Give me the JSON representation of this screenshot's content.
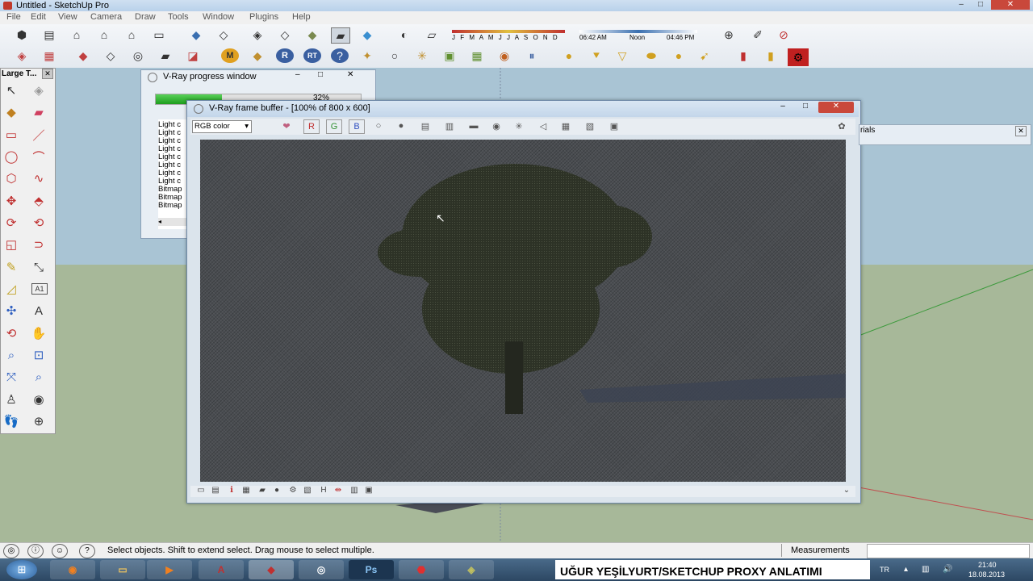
{
  "window": {
    "title": "Untitled - SketchUp Pro"
  },
  "menu": [
    "File",
    "Edit",
    "View",
    "Camera",
    "Draw",
    "Tools",
    "Window",
    "Plugins",
    "Help"
  ],
  "shadow": {
    "months": "J F M A M J J A S O N D",
    "time_start": "06:42 AM",
    "time_noon": "Noon",
    "time_end": "04:46 PM"
  },
  "toolbar_labels": {
    "m": "M",
    "r": "R",
    "rt": "RT",
    "a1": "A1"
  },
  "large_tools": {
    "title": "Large T..."
  },
  "progress_window": {
    "title": "V-Ray progress window",
    "percent": "32%",
    "progress": 0.32,
    "log": [
      "Light c",
      "Light c",
      "Light c",
      "Light c",
      "Light c",
      "Light c",
      "Light c",
      "Light c",
      "Bitmap",
      "Bitmap",
      "Bitmap"
    ]
  },
  "frame_buffer": {
    "title": "V-Ray frame buffer - [100% of 800 x 600]",
    "channel": "RGB color",
    "channels": {
      "r": "R",
      "g": "G",
      "b": "B"
    }
  },
  "materials": {
    "label": "rials"
  },
  "statusbar": {
    "hint": "Select objects. Shift to extend select. Drag mouse to select multiple.",
    "measurements": "Measurements"
  },
  "taskbar": {
    "caption": "UĞUR YEŞİLYURT/SKETCHUP PROXY ANLATIMI",
    "lang": "TR",
    "time": "21:40",
    "date": "18.08.2013"
  },
  "colors": {
    "accent": "#1e9e1e",
    "title_bg": "#c3d6ea",
    "sky": "#a9c4d4",
    "ground": "#a7b899",
    "taskbar": "#2c4763"
  }
}
